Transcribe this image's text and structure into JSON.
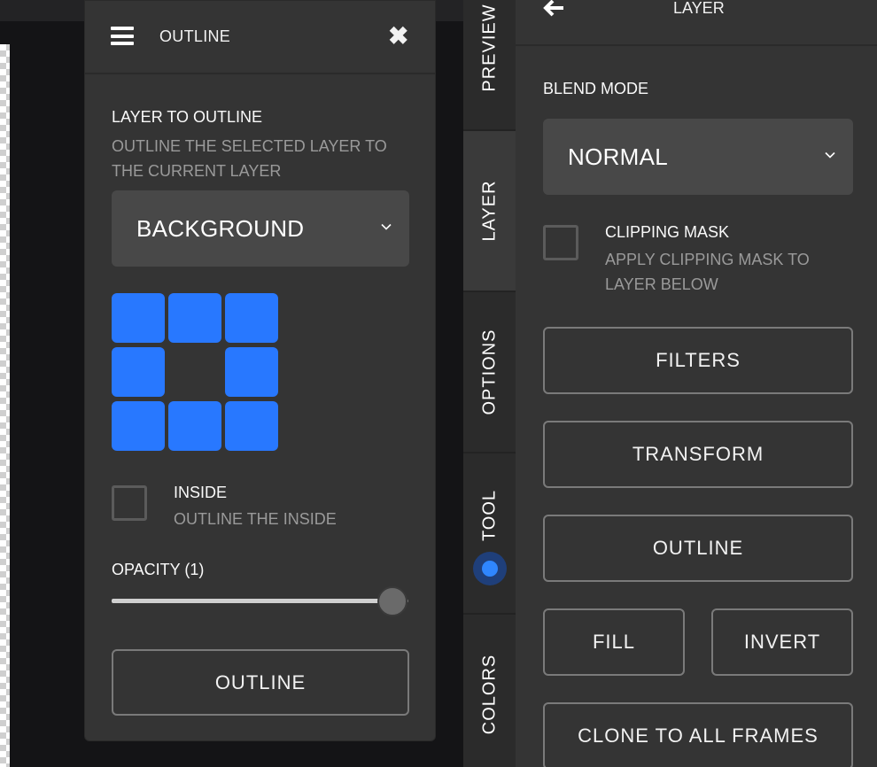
{
  "outline_dialog": {
    "title": "OUTLINE",
    "layer_to_outline_label": "LAYER TO OUTLINE",
    "layer_to_outline_desc": "OUTLINE THE SELECTED LAYER TO THE CURRENT LAYER",
    "layer_select_value": "BACKGROUND",
    "inside_label": "INSIDE",
    "inside_desc": "OUTLINE THE INSIDE",
    "opacity_label": "OPACITY (1)",
    "opacity_value": 1,
    "outline_button": "OUTLINE",
    "accent_color": "#2878ff"
  },
  "tabs": [
    {
      "label": "PREVIEW"
    },
    {
      "label": "LAYER"
    },
    {
      "label": "OPTIONS"
    },
    {
      "label": "TOOL"
    },
    {
      "label": "COLORS"
    }
  ],
  "layer_panel": {
    "title": "LAYER",
    "blend_mode_label": "BLEND MODE",
    "blend_mode_value": "NORMAL",
    "clipping_mask_label": "CLIPPING MASK",
    "clipping_mask_desc": "APPLY CLIPPING MASK TO LAYER BELOW",
    "buttons": {
      "filters": "FILTERS",
      "transform": "TRANSFORM",
      "outline": "OUTLINE",
      "fill": "FILL",
      "invert": "INVERT",
      "clone": "CLONE TO ALL FRAMES"
    }
  }
}
